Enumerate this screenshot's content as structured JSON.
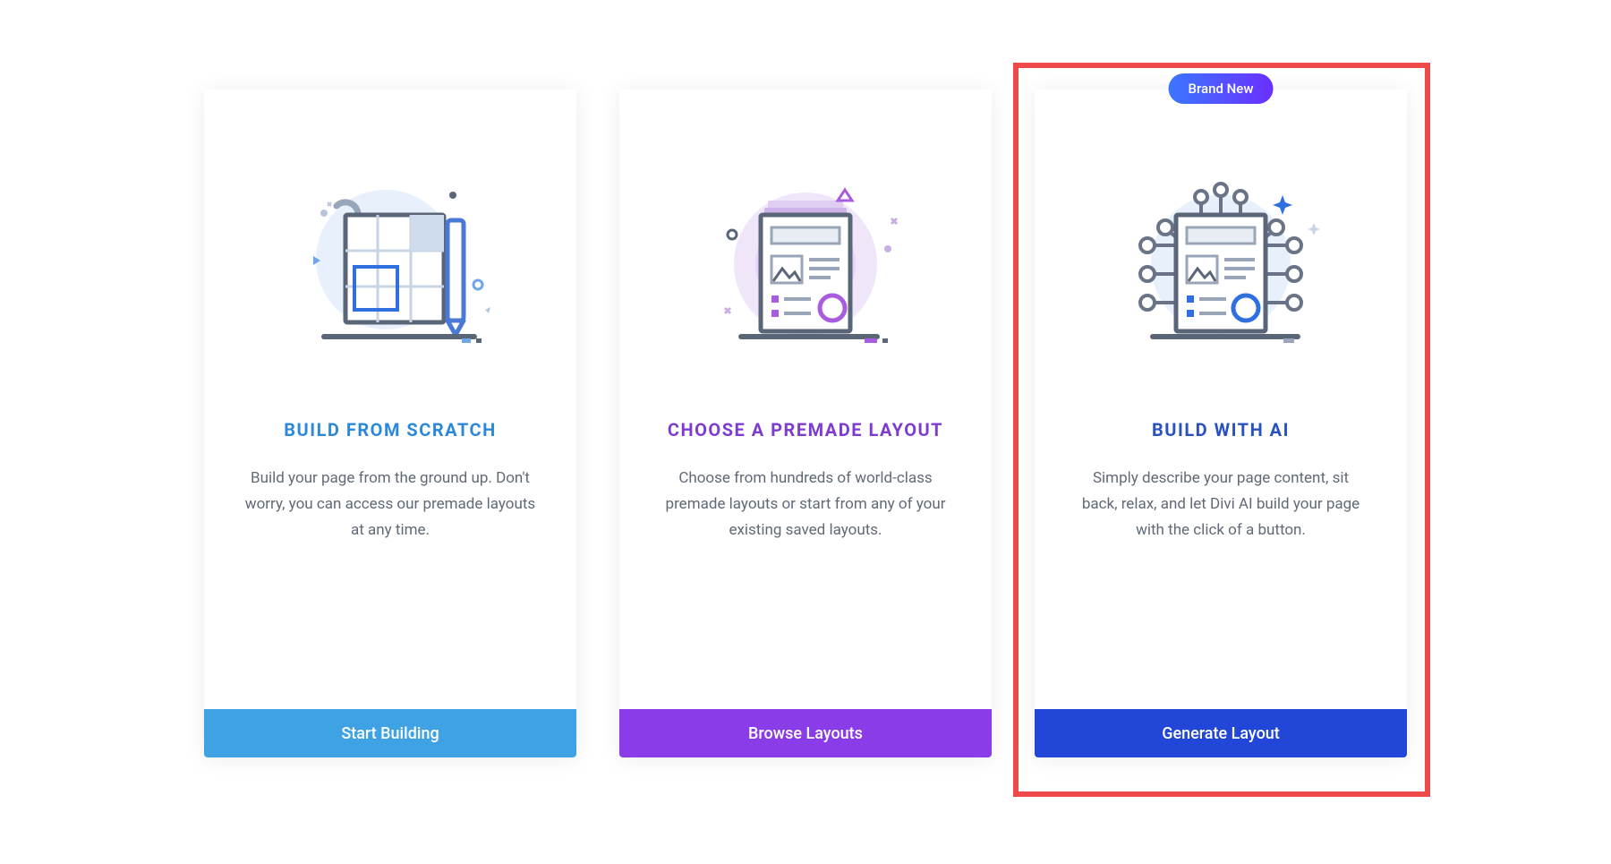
{
  "badge": {
    "brand_new": "Brand New"
  },
  "cards": [
    {
      "title": "BUILD FROM SCRATCH",
      "desc": "Build your page from the ground up. Don't worry, you can access our premade layouts at any time.",
      "button": "Start Building"
    },
    {
      "title": "CHOOSE A PREMADE LAYOUT",
      "desc": "Choose from hundreds of world-class premade layouts or start from any of your existing saved layouts.",
      "button": "Browse Layouts"
    },
    {
      "title": "BUILD WITH AI",
      "desc": "Simply describe your page content, sit back, relax, and let Divi AI build your page with the click of a button.",
      "button": "Generate Layout"
    }
  ],
  "colors": {
    "accent_blue": "#3ea2e5",
    "accent_purple": "#8a3ce8",
    "accent_royal": "#2146d8",
    "highlight_red": "#ef4a4a"
  }
}
